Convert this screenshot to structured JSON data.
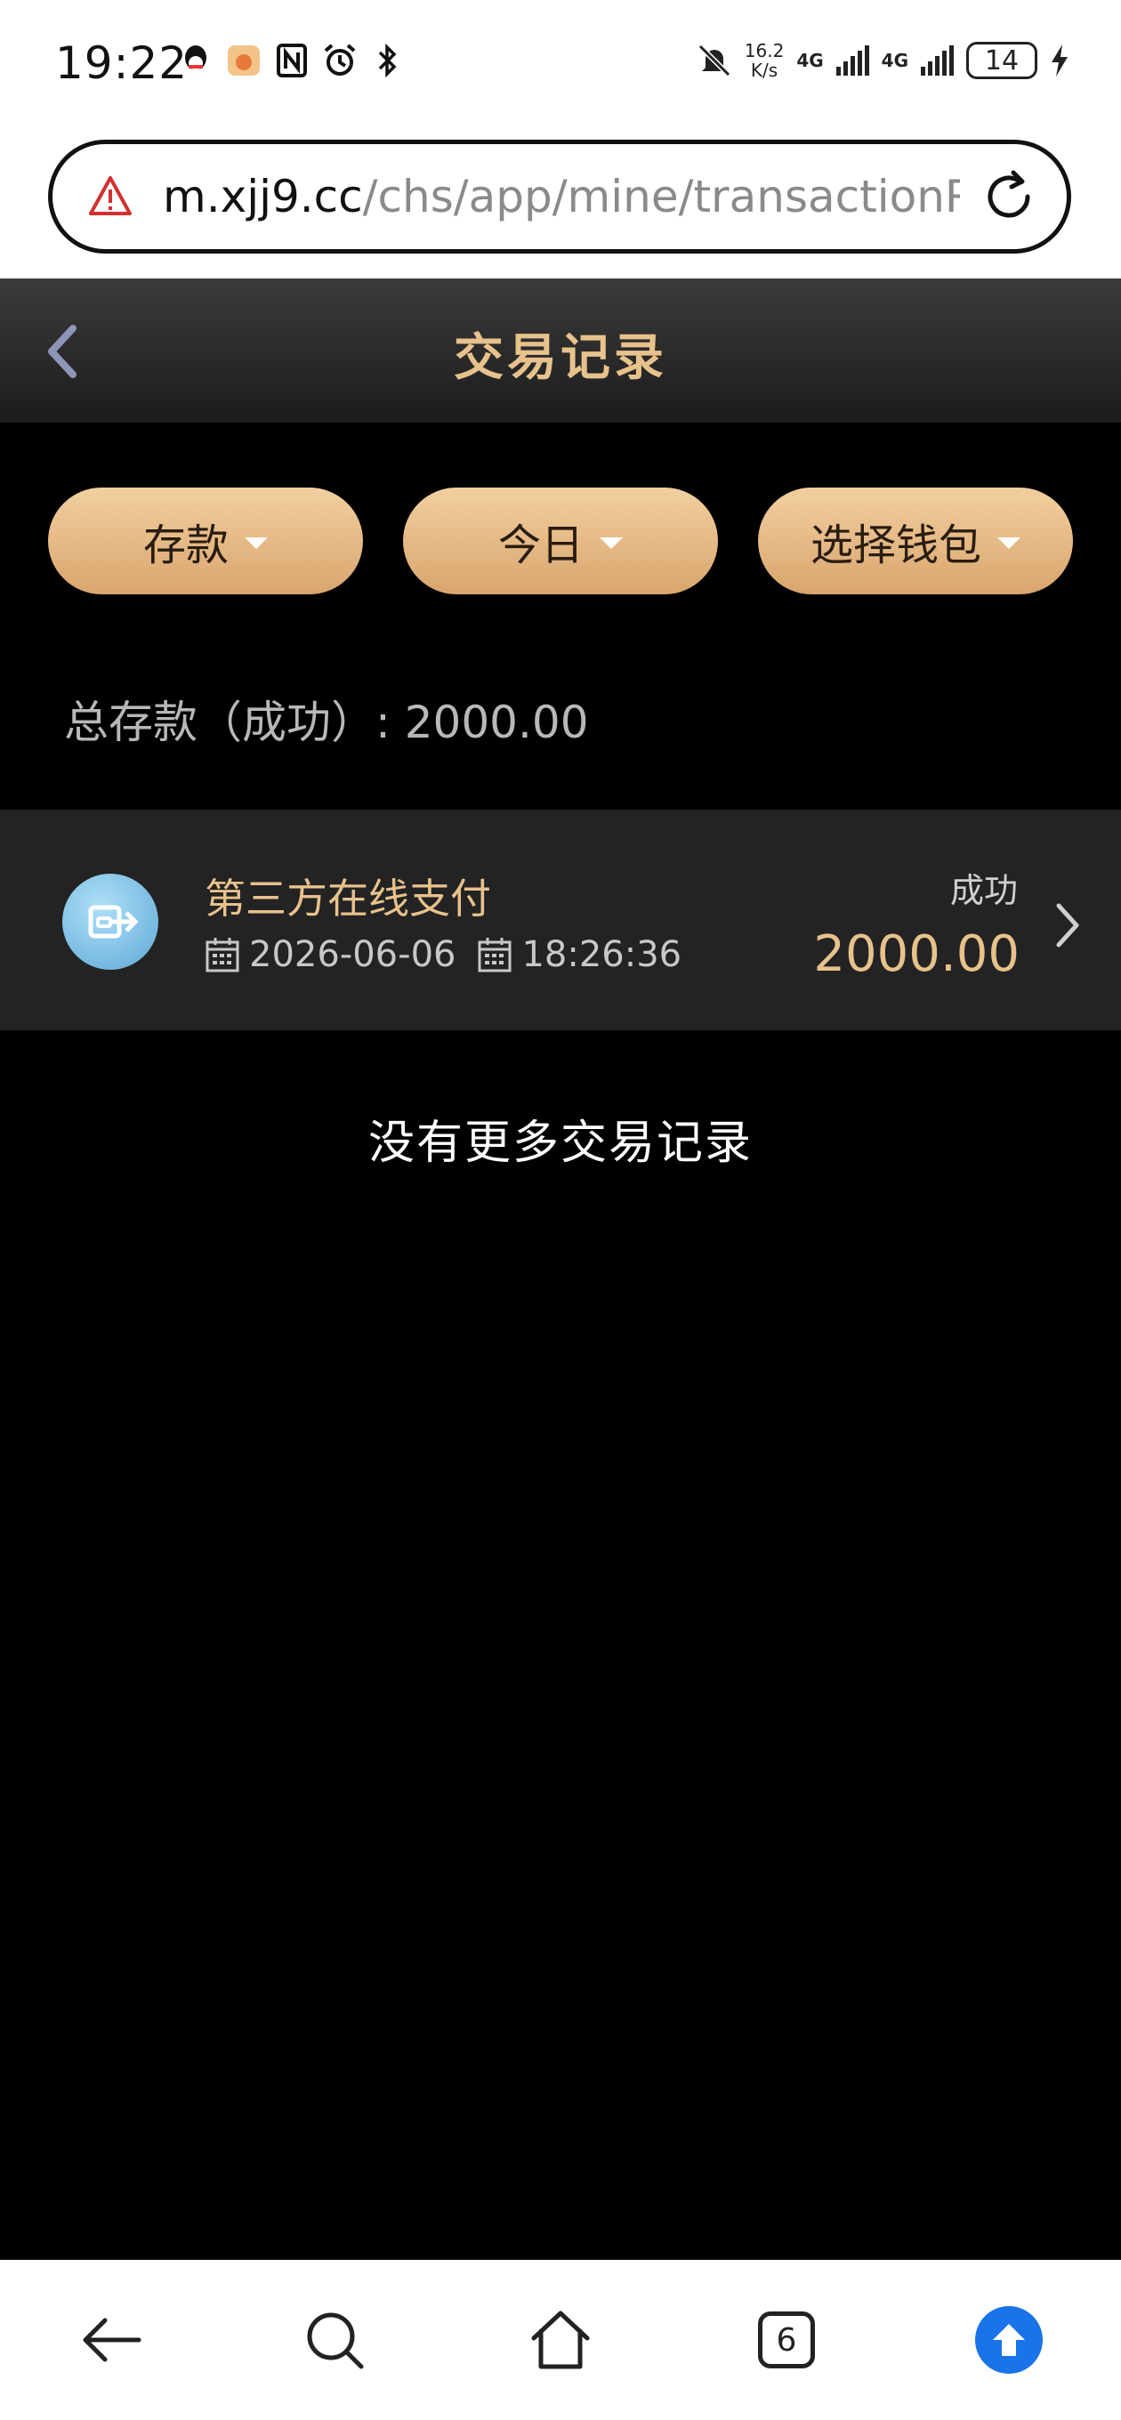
{
  "status_bar": {
    "time": "19:22",
    "speed_value": "16.2",
    "speed_unit": "K/s",
    "network_1": "4G",
    "network_2": "4G",
    "battery": "14"
  },
  "browser": {
    "url_host": "m.xjj9.cc",
    "url_path": "/chs/app/mine/transactionRe"
  },
  "header": {
    "title": "交易记录"
  },
  "filters": [
    {
      "label": "存款"
    },
    {
      "label": "今日"
    },
    {
      "label": "选择钱包"
    }
  ],
  "summary": {
    "total_label": "总存款（成功）: 2000.00"
  },
  "records": [
    {
      "title": "第三方在线支付",
      "date": "2026-06-06",
      "time": "18:26:36",
      "status": "成功",
      "amount": "2000.00"
    }
  ],
  "footer_message": "没有更多交易记录",
  "bottom_nav": {
    "tabs_count": "6"
  },
  "colors": {
    "accent_gold": "#e8c28c",
    "background": "#000000",
    "button_gradient_top": "#f2cfa0",
    "button_gradient_bottom": "#d9a56d",
    "upload_blue": "#1a73e8"
  }
}
